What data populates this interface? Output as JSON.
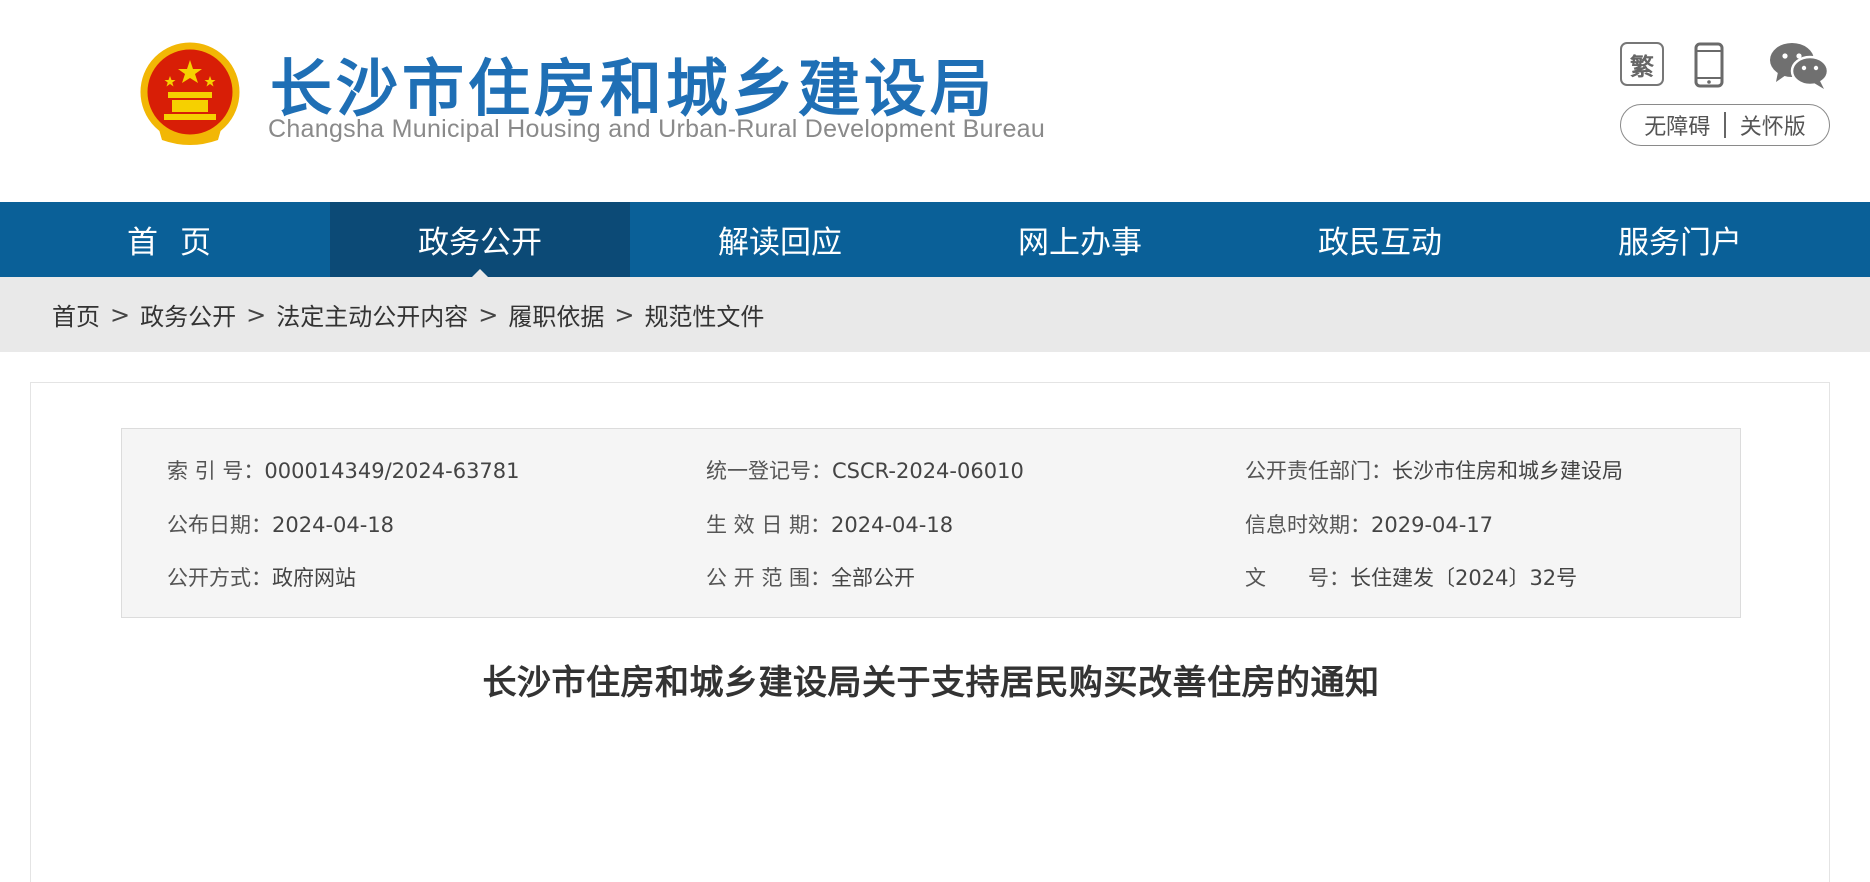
{
  "header": {
    "title": "长沙市住房和城乡建设局",
    "subtitle": "Changsha Municipal Housing and Urban-Rural Development Bureau",
    "traditional_label": "繁",
    "accessibility_label": "无障碍",
    "elderly_label": "关怀版",
    "brand_color": "#1f6fb5"
  },
  "nav": {
    "items": [
      {
        "label": "首页"
      },
      {
        "label": "政务公开"
      },
      {
        "label": "解读回应"
      },
      {
        "label": "网上办事"
      },
      {
        "label": "政民互动"
      },
      {
        "label": "服务门户"
      }
    ],
    "active_index": 1,
    "color": "#0a6098",
    "active_color": "#0c4a76"
  },
  "breadcrumb": {
    "items": [
      "首页",
      "政务公开",
      "法定主动公开内容",
      "履职依据",
      "规范性文件"
    ],
    "separator": ">"
  },
  "meta": {
    "index_label": "索 引 号：",
    "index_value": "000014349/2024-63781",
    "reg_label": "统一登记号：",
    "reg_value": "CSCR-2024-06010",
    "dept_label": "公开责任部门：",
    "dept_value": "长沙市住房和城乡建设局",
    "publish_label": "公布日期：",
    "publish_value": "2024-04-18",
    "effective_label": "生 效 日 期：",
    "effective_value": "2024-04-18",
    "expiry_label": "信息时效期：",
    "expiry_value": "2029-04-17",
    "method_label": "公开方式：",
    "method_value": "政府网站",
    "scope_label": "公 开 范 围：",
    "scope_value": "全部公开",
    "docno_label": "文　　号：",
    "docno_value": "长住建发〔2024〕32号"
  },
  "document": {
    "title": "长沙市住房和城乡建设局关于支持居民购买改善住房的通知"
  }
}
